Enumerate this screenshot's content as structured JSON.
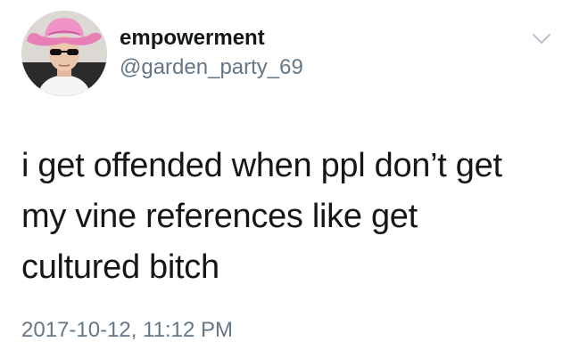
{
  "author": {
    "display_name": "empowerment",
    "handle": "@garden_party_69"
  },
  "icons": {
    "avatar": "avatar-photo",
    "menu": "chevron-down-icon"
  },
  "tweet": {
    "lines": [
      "i get offended when ppl don’t get",
      "my vine references like get",
      "cultured bitch"
    ],
    "timestamp": "2017-10-12, 11:12 PM"
  },
  "colors": {
    "text": "#14171a",
    "secondary": "#657786",
    "hat_pink": "#e880b8"
  }
}
